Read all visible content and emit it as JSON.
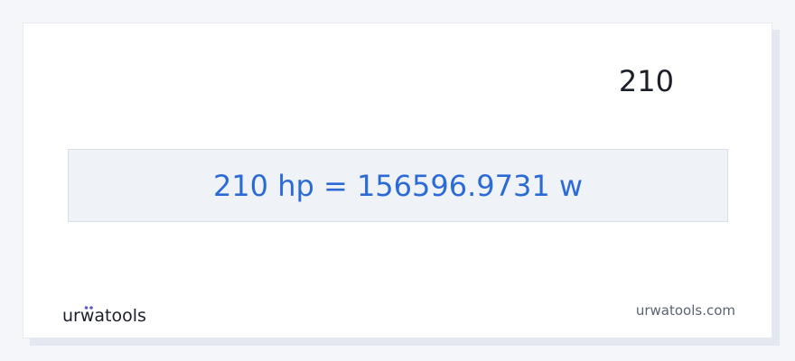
{
  "converter": {
    "input_value": "210",
    "result": "210 hp = 156596.9731 w"
  },
  "brand": {
    "logo_text": "urwatools",
    "url": "urwatools.com"
  },
  "colors": {
    "result_text": "#2c6bd6",
    "result_background": "#eff3f8",
    "logo_accent": "#5b5bd6",
    "text_dark": "#1b1f2a"
  },
  "icons": [
    "urwatools-logo-icon"
  ]
}
